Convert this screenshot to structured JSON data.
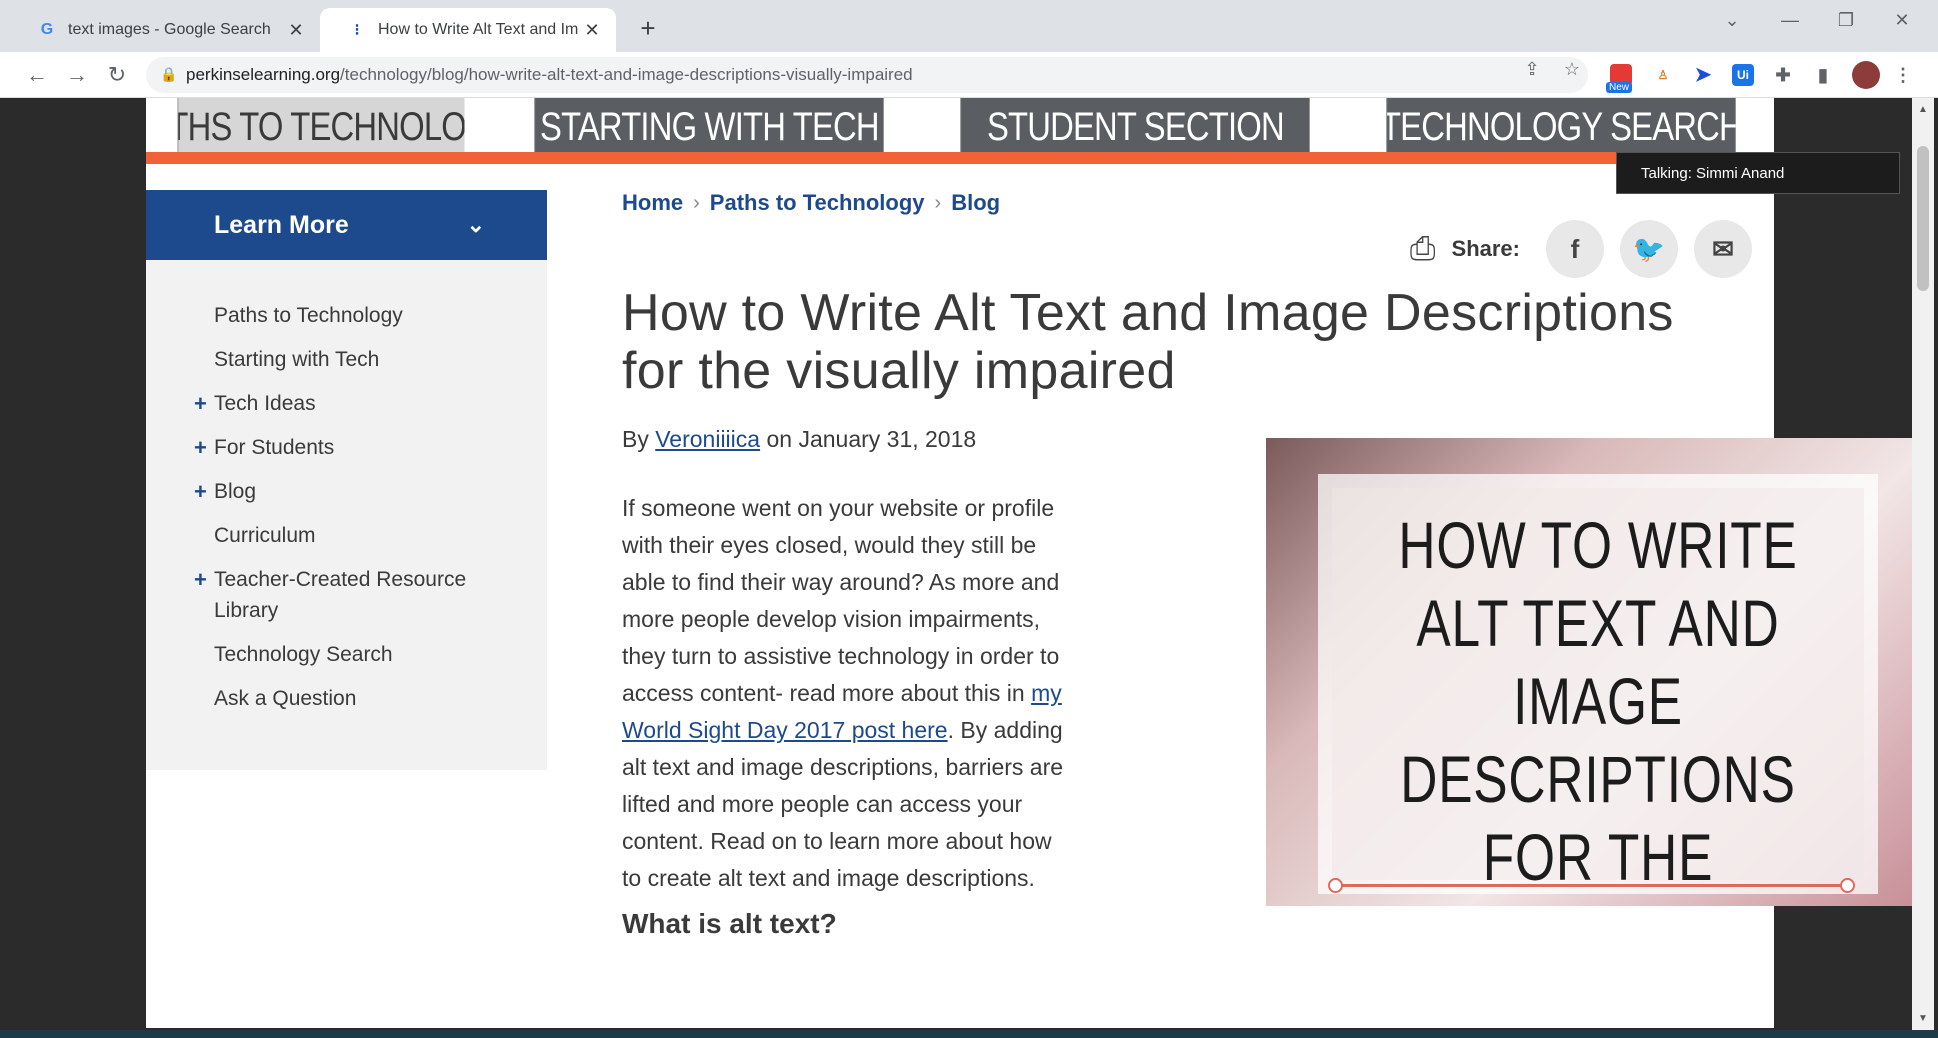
{
  "browser": {
    "tabs": [
      {
        "title": "text images - Google Search",
        "favicon": "G"
      },
      {
        "title": "How to Write Alt Text and Image",
        "favicon": "⁝"
      }
    ],
    "new_tab": "+",
    "url_host": "perkinselearning.org",
    "url_path": "/technology/blog/how-write-alt-text-and-image-descriptions-visually-impaired",
    "ext_badge": "New"
  },
  "site": {
    "topnav": [
      "PATHS TO TECHNOLOGY",
      "STARTING WITH TECH",
      "STUDENT SECTION",
      "TECHNOLOGY SEARCH"
    ],
    "sidebar": {
      "heading": "Learn More",
      "items": [
        {
          "label": "Paths to Technology",
          "plus": ""
        },
        {
          "label": "Starting with Tech",
          "plus": ""
        },
        {
          "label": "Tech Ideas",
          "plus": "+"
        },
        {
          "label": "For Students",
          "plus": "+"
        },
        {
          "label": "Blog",
          "plus": "+"
        },
        {
          "label": "Curriculum",
          "plus": ""
        },
        {
          "label": "Teacher-Created Resource Library",
          "plus": "+"
        },
        {
          "label": "Technology Search",
          "plus": ""
        },
        {
          "label": "Ask a Question",
          "plus": ""
        }
      ]
    },
    "breadcrumb": [
      "Home",
      "Paths to Technology",
      "Blog"
    ],
    "share_label": "Share:",
    "article": {
      "title": "How to Write Alt Text and Image Descriptions for the visually impaired",
      "by": "By",
      "author": "Veroniiiica",
      "date_text": "on January 31, 2018",
      "para_before": "If someone went on your website or profile with their eyes closed, would they still be able to find their way around? As more and more people develop vision impairments, they turn to assistive technology in order to access content- read more about this in ",
      "para_link": "my World Sight Day 2017 post here",
      "para_after": ". By adding alt text and image descriptions, barriers are lifted and more people can access your content. Read on to learn more about how to create alt text and image descriptions.",
      "subheading": "What is alt text?",
      "hero_text": "HOW TO WRITE ALT TEXT AND IMAGE DESCRIPTIONS FOR THE VISUALLY IMPAIRED"
    }
  },
  "tooltip": "Talking: Simmi Anand"
}
